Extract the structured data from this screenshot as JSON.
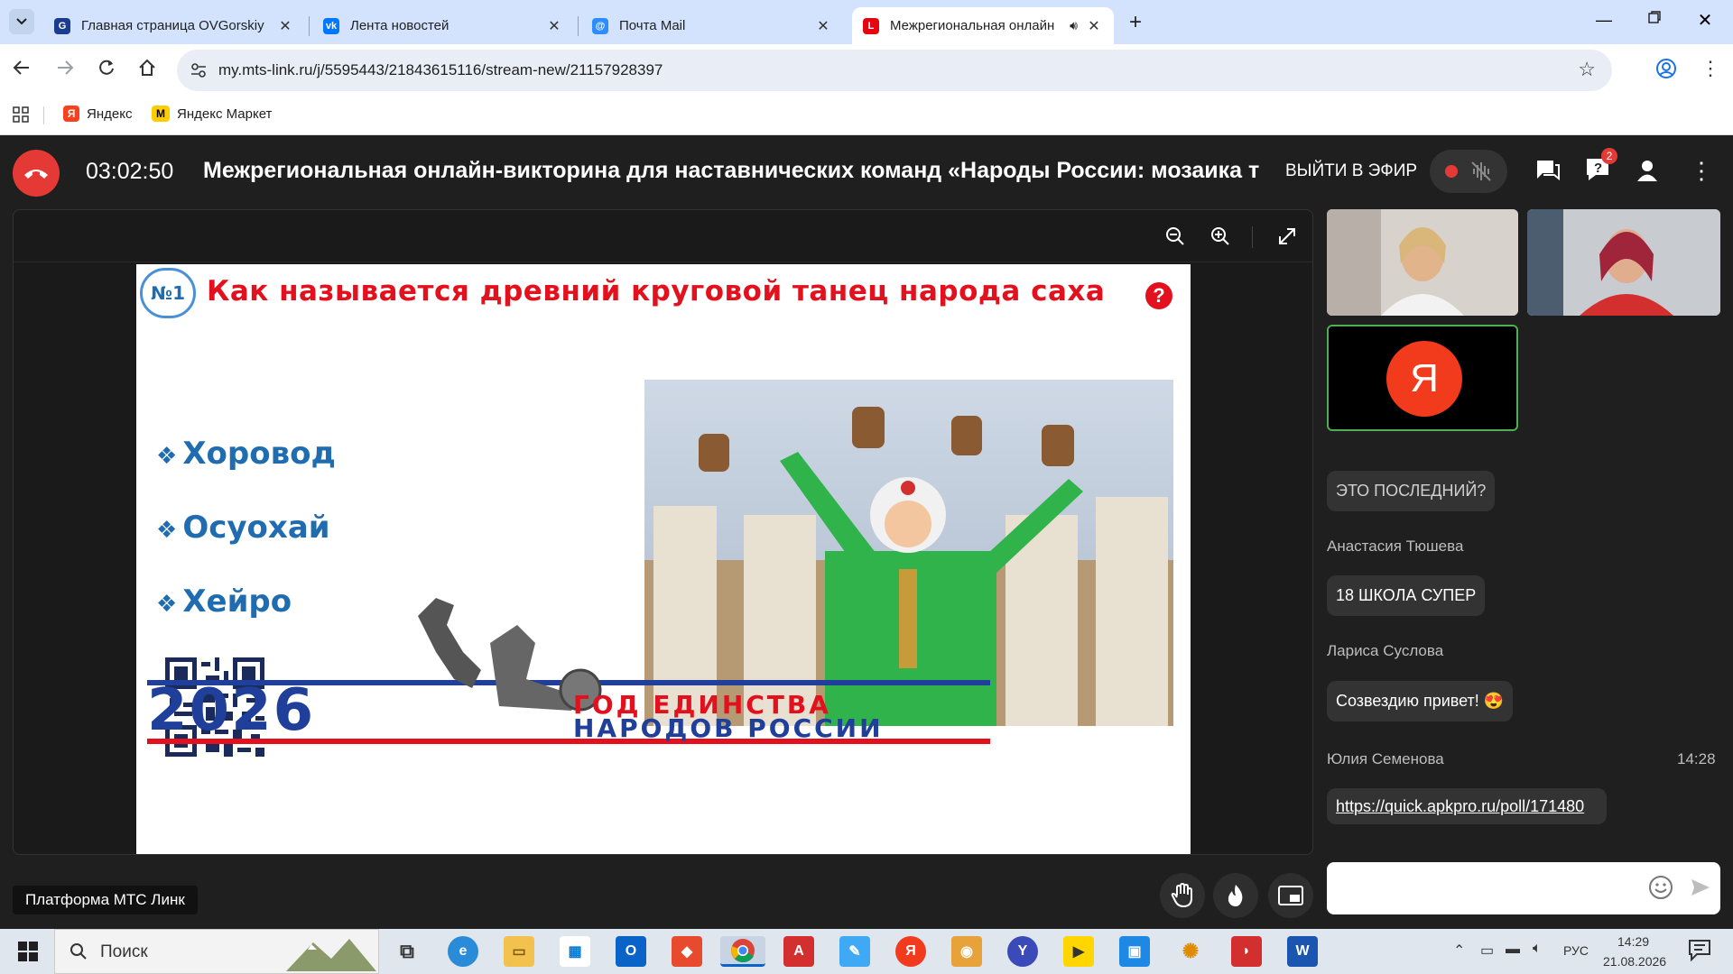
{
  "browser": {
    "tabs": [
      {
        "title": "Главная страница OVGorskiy"
      },
      {
        "title": "Лента новостей"
      },
      {
        "title": "Почта Mail"
      },
      {
        "title": "Межрегиональная онлайн"
      }
    ],
    "new_tab_symbol": "+",
    "url": "my.mts-link.ru/j/5595443/21843615116/stream-new/21157928397",
    "bookmarks": [
      {
        "label": "Яндекс"
      },
      {
        "label": "Яндекс Маркет"
      }
    ]
  },
  "webinar": {
    "timer": "03:02:50",
    "title": "Межрегиональная онлайн-викторина для наставнических команд «Народы России: мозаика тра",
    "go_live_label": "ВЫЙТИ В ЭФИР",
    "questions_badge": "2",
    "accent_red": "#e53935",
    "border_green": "#4caf50"
  },
  "slide": {
    "number": "№1",
    "question": "Как называется древний круговой танец народа саха",
    "options": [
      {
        "label": "Хоровод"
      },
      {
        "label": "Осуохай"
      },
      {
        "label": "Хейро"
      }
    ],
    "year": "2026",
    "year_caption_line1": "ГОД ЕДИНСТВА",
    "year_caption_line2": "НАРОДОВ РОССИИ"
  },
  "participants": {
    "self_avatar_letter": "Я"
  },
  "chat": {
    "messages": [
      {
        "author": "",
        "text": "ЭТО ПОСЛЕДНИЙ?",
        "time": ""
      },
      {
        "author": "Анастасия Тюшева",
        "text": "18 ШКОЛА СУПЕР",
        "time": ""
      },
      {
        "author": "Лариса Суслова",
        "text": "Созвездию привет! 😍",
        "time": ""
      },
      {
        "author": "Юлия Семенова",
        "text": "https://quick.apkpro.ru/poll/171480",
        "time": "14:28"
      }
    ]
  },
  "platform_label": "Платформа МТС Линк",
  "taskbar": {
    "search_placeholder": "Поиск",
    "language": "РУС",
    "time": "14:29",
    "date": "21.08.2026"
  }
}
